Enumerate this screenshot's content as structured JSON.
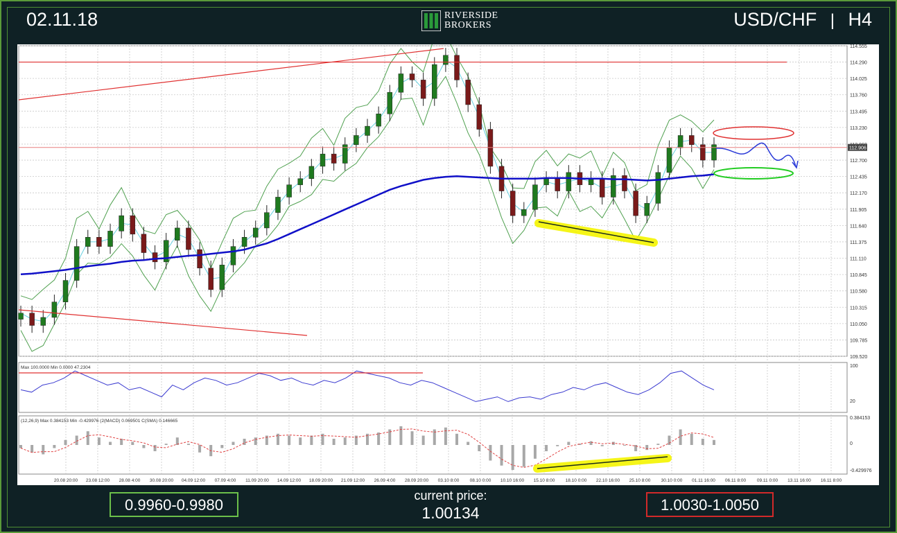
{
  "header": {
    "date": "02.11.18",
    "instrument": "USD/CHF",
    "separator": "|",
    "timeframe": "H4",
    "logo_line1": "RIVERSIDE",
    "logo_line2": "BROKERS"
  },
  "footer": {
    "support_range": "0.9960-0.9980",
    "current_price_label": "current price:",
    "current_price_value": "1.00134",
    "resistance_range": "1.0030-1.0050"
  },
  "colors": {
    "frame_border": "#5a9a3a",
    "background": "#0f2125",
    "support_box": "#6cc04a",
    "resistance_box": "#d32a2a",
    "candle_up": "#1f7a1f",
    "candle_down": "#7a1a1a",
    "bollinger": "#4fa04f",
    "moving_average": "#1010c8",
    "fast_ma": "#66d0e0",
    "trendline": "#e03030",
    "highlight": "#f5f500",
    "rsi_line": "#3a3ad0",
    "macd_hist": "#a8a8a8",
    "macd_signal": "#e04040"
  },
  "chart_data": {
    "type": "candlestick",
    "price_axis_ticks": [
      "114.555",
      "114.290",
      "114.025",
      "113.760",
      "113.495",
      "113.230",
      "112.960",
      "112.700",
      "112.435",
      "112.170",
      "111.905",
      "111.640",
      "111.375",
      "111.110",
      "110.845",
      "110.580",
      "110.315",
      "110.050",
      "109.785",
      "109.520"
    ],
    "current_price_tag": "112.906",
    "time_axis_ticks": [
      "20.08 20:00",
      "23.08 12:00",
      "28.08 4:00",
      "30.08 20:00",
      "04.09 12:00",
      "07.09 4:00",
      "11.09 20:00",
      "14.09 12:00",
      "18.09 20:00",
      "21.09 12:00",
      "26.09 4:00",
      "28.09 20:00",
      "03.10 8:00",
      "08.10 0:00",
      "10.10 16:00",
      "15.10 8:00",
      "18.10 0:00",
      "22.10 16:00",
      "25.10 8:00",
      "30.10 0:00",
      "01.11 16:00",
      "06.11 8:00",
      "09.11 0:00",
      "13.11 16:00",
      "16.11 8:00"
    ],
    "close_values": [
      110.22,
      110.02,
      110.15,
      110.4,
      110.75,
      111.3,
      111.45,
      111.3,
      111.55,
      111.8,
      111.5,
      111.2,
      111.05,
      111.4,
      111.6,
      111.25,
      110.95,
      110.6,
      111.0,
      111.3,
      111.45,
      111.6,
      111.85,
      112.1,
      112.3,
      112.4,
      112.6,
      112.8,
      112.65,
      112.95,
      113.1,
      113.25,
      113.45,
      113.8,
      114.1,
      114.0,
      113.7,
      114.25,
      114.4,
      114.0,
      113.6,
      113.2,
      112.6,
      112.2,
      111.8,
      111.9,
      112.3,
      112.4,
      112.2,
      112.5,
      112.3,
      112.4,
      112.1,
      112.45,
      112.2,
      111.8,
      112.0,
      112.5,
      112.9,
      113.1,
      112.95,
      112.7,
      112.95
    ],
    "ma_values": [
      110.85,
      110.86,
      110.88,
      110.9,
      110.92,
      110.95,
      110.98,
      111.0,
      111.02,
      111.05,
      111.07,
      111.08,
      111.1,
      111.11,
      111.13,
      111.15,
      111.16,
      111.18,
      111.2,
      111.22,
      111.25,
      111.3,
      111.35,
      111.42,
      111.5,
      111.58,
      111.66,
      111.74,
      111.82,
      111.9,
      111.98,
      112.06,
      112.14,
      112.22,
      112.28,
      112.33,
      112.38,
      112.41,
      112.43,
      112.44,
      112.43,
      112.42,
      112.41,
      112.4,
      112.4,
      112.4,
      112.4,
      112.41,
      112.41,
      112.41,
      112.4,
      112.4,
      112.4,
      112.39,
      112.39,
      112.38,
      112.37,
      112.38,
      112.4,
      112.42,
      112.44,
      112.45,
      112.47
    ],
    "resistance_lines": [
      114.29,
      112.906
    ],
    "rsi_panel": {
      "header": "Max 100.0000  Min 0.0000  47.2304",
      "scale": [
        "100",
        "20"
      ],
      "values": [
        45,
        40,
        55,
        60,
        70,
        85,
        75,
        65,
        55,
        60,
        45,
        50,
        40,
        30,
        55,
        45,
        60,
        70,
        65,
        55,
        60,
        70,
        80,
        75,
        65,
        70,
        60,
        55,
        65,
        60,
        70,
        85,
        80,
        75,
        70,
        60,
        55,
        65,
        60,
        50,
        40,
        30,
        20,
        25,
        30,
        20,
        28,
        30,
        25,
        35,
        40,
        50,
        45,
        55,
        60,
        50,
        40,
        35,
        45,
        60,
        80,
        85,
        70,
        55,
        45
      ]
    },
    "macd_panel": {
      "header": "(12,26,9)  Max 0.384153  Min -0.429976  (2(MACD) 0.069501  C(SMA) 0.146665",
      "scale": [
        "0.384153",
        "0",
        "-0.429976"
      ],
      "histogram": [
        -0.05,
        -0.12,
        -0.15,
        -0.05,
        0.08,
        0.15,
        0.22,
        0.12,
        0.05,
        0.1,
        0.05,
        -0.05,
        -0.1,
        0.02,
        0.12,
        0.02,
        -0.12,
        -0.18,
        -0.05,
        0.05,
        0.1,
        0.12,
        0.15,
        0.18,
        0.15,
        0.12,
        0.15,
        0.18,
        0.1,
        0.12,
        0.15,
        0.18,
        0.2,
        0.25,
        0.3,
        0.22,
        0.15,
        0.25,
        0.28,
        0.18,
        0.05,
        -0.1,
        -0.25,
        -0.33,
        -0.4,
        -0.35,
        -0.22,
        -0.1,
        -0.02,
        0.05,
        0.02,
        0.06,
        -0.02,
        0.05,
        0.0,
        -0.1,
        -0.08,
        0.02,
        0.15,
        0.25,
        0.18,
        0.1,
        0.08
      ]
    }
  }
}
